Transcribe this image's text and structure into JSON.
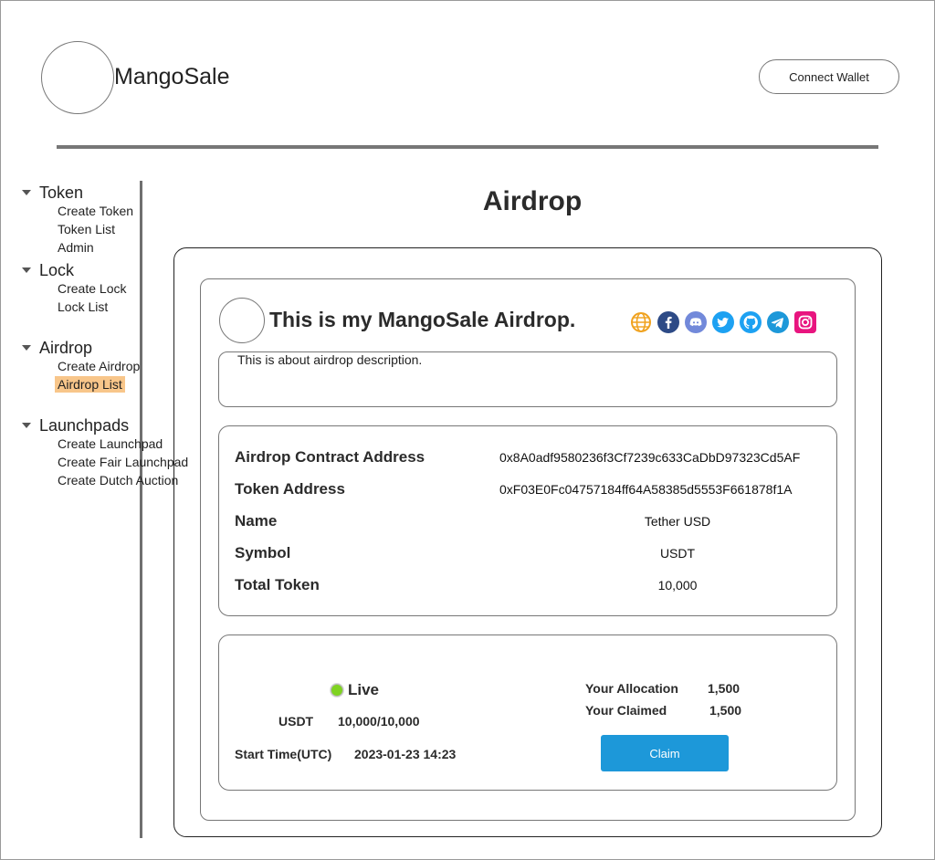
{
  "header": {
    "brand": "MangoSale",
    "connect_wallet_label": "Connect Wallet"
  },
  "sidebar": {
    "groups": [
      {
        "label": "Token",
        "items": [
          "Create Token",
          "Token List",
          "Admin"
        ]
      },
      {
        "label": "Lock",
        "items": [
          "Create Lock",
          "Lock List"
        ]
      },
      {
        "label": "Airdrop",
        "items": [
          "Create Airdrop",
          "Airdrop List"
        ],
        "active_item": "Airdrop List"
      },
      {
        "label": "Launchpads",
        "items": [
          "Create Launchpad",
          "Create Fair Launchpad",
          "Create Dutch Auction"
        ]
      }
    ]
  },
  "page": {
    "title": "Airdrop"
  },
  "airdrop": {
    "title": "This is my MangoSale Airdrop.",
    "description": "This is about airdrop description.",
    "socials": [
      {
        "icon": "globe-icon",
        "color": "#f0a21f"
      },
      {
        "icon": "facebook-icon",
        "color": "#2d4a86"
      },
      {
        "icon": "discord-icon",
        "color": "#7289da"
      },
      {
        "icon": "twitter-icon",
        "color": "#1da1f2"
      },
      {
        "icon": "github-icon",
        "color": "#1da1f2"
      },
      {
        "icon": "telegram-icon",
        "color": "#1d98d9"
      },
      {
        "icon": "instagram-icon",
        "color": "#e8157f"
      }
    ],
    "info": {
      "contract_label": "Airdrop Contract Address",
      "contract_value": "0x8A0adf9580236f3Cf7239c633CaDbD97323Cd5AF",
      "token_label": "Token Address",
      "token_value": "0xF03E0Fc04757184ff64A58385d5553F661878f1A",
      "name_label": "Name",
      "name_value": "Tether USD",
      "symbol_label": "Symbol",
      "symbol_value": "USDT",
      "total_label": "Total Token",
      "total_value": "10,000"
    },
    "status": {
      "live_label": "Live",
      "live_color": "#7fd321",
      "symbol": "USDT",
      "progress": "10,000/10,000",
      "start_label": "Start Time(UTC)",
      "start_value": "2023-01-23 14:23",
      "allocation_label": "Your Allocation",
      "allocation_value": "1,500",
      "claimed_label": "Your Claimed",
      "claimed_value": "1,500",
      "claim_label": "Claim",
      "claim_color": "#1d98d9"
    }
  }
}
